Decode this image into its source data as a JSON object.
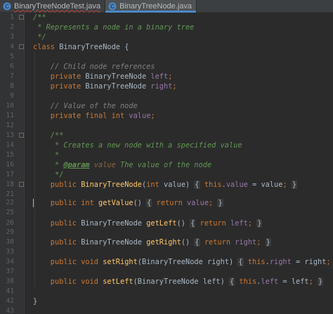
{
  "tabs": [
    {
      "label": "BinaryTreeNodeTest.java",
      "active": false,
      "error": true,
      "icon": "java-class-icon"
    },
    {
      "label": "BinaryTreeNode.java",
      "active": true,
      "error": false,
      "icon": "java-class-icon"
    }
  ],
  "theme": {
    "background": "#2b2b2b",
    "keyword": "#cc7832",
    "method": "#ffc66d",
    "field": "#9876aa",
    "comment": "#808080",
    "javadoc": "#629755",
    "accent": "#4a88c7"
  },
  "current_line_number": "22",
  "code": [
    {
      "n": "1",
      "tokens": [
        [
          "/**",
          "doc"
        ]
      ]
    },
    {
      "n": "2",
      "tokens": [
        [
          " * Represents a node in a binary tree",
          "doc"
        ]
      ]
    },
    {
      "n": "3",
      "tokens": [
        [
          " */",
          "doc"
        ]
      ]
    },
    {
      "n": "4",
      "tokens": [
        [
          "class ",
          "kw"
        ],
        [
          "BinaryTreeNode {",
          "plain"
        ]
      ]
    },
    {
      "n": "5",
      "tokens": []
    },
    {
      "n": "6",
      "tokens": [
        [
          "    // Child node references",
          "cm"
        ]
      ]
    },
    {
      "n": "7",
      "tokens": [
        [
          "    private ",
          "kw"
        ],
        [
          "BinaryTreeNode ",
          "plain"
        ],
        [
          "left",
          "fld"
        ],
        [
          ";",
          "kw"
        ]
      ]
    },
    {
      "n": "8",
      "tokens": [
        [
          "    private ",
          "kw"
        ],
        [
          "BinaryTreeNode ",
          "plain"
        ],
        [
          "right",
          "fld"
        ],
        [
          ";",
          "kw"
        ]
      ]
    },
    {
      "n": "9",
      "tokens": []
    },
    {
      "n": "10",
      "tokens": [
        [
          "    // Value of the node",
          "cm"
        ]
      ]
    },
    {
      "n": "11",
      "tokens": [
        [
          "    private final int ",
          "kw"
        ],
        [
          "value",
          "fld"
        ],
        [
          ";",
          "kw"
        ]
      ]
    },
    {
      "n": "12",
      "tokens": []
    },
    {
      "n": "13",
      "tokens": [
        [
          "    /**",
          "doc"
        ]
      ]
    },
    {
      "n": "14",
      "tokens": [
        [
          "     * Creates a new node with a specified value",
          "doc"
        ]
      ]
    },
    {
      "n": "15",
      "tokens": [
        [
          "     *",
          "doc"
        ]
      ]
    },
    {
      "n": "16",
      "tokens": [
        [
          "     * ",
          "doc"
        ],
        [
          "@param",
          "doctag"
        ],
        [
          " ",
          "doc"
        ],
        [
          "value",
          "docval"
        ],
        [
          " The value of the node",
          "doc"
        ]
      ]
    },
    {
      "n": "17",
      "tokens": [
        [
          "     */",
          "doc"
        ]
      ]
    },
    {
      "n": "18",
      "tokens": [
        [
          "    public ",
          "kw"
        ],
        [
          "BinaryTreeNode",
          "fn"
        ],
        [
          "(",
          "plain"
        ],
        [
          "int ",
          "kw"
        ],
        [
          "value) ",
          "plain"
        ],
        [
          "{",
          "brace"
        ],
        [
          " ",
          "plain"
        ],
        [
          "this",
          "kw"
        ],
        [
          ".",
          "plain"
        ],
        [
          "value",
          "fld"
        ],
        [
          " = value",
          "plain"
        ],
        [
          "; ",
          "kw"
        ],
        [
          "}",
          "brace"
        ]
      ]
    },
    {
      "n": "21",
      "tokens": []
    },
    {
      "n": "22",
      "tokens": [
        [
          "    public int ",
          "kw"
        ],
        [
          "getValue",
          "fn"
        ],
        [
          "() ",
          "plain"
        ],
        [
          "{",
          "brace"
        ],
        [
          " ",
          "plain"
        ],
        [
          "return ",
          "kw"
        ],
        [
          "value",
          "fld"
        ],
        [
          "; ",
          "kw"
        ],
        [
          "}",
          "brace"
        ]
      ]
    },
    {
      "n": "25",
      "tokens": []
    },
    {
      "n": "26",
      "tokens": [
        [
          "    public ",
          "kw"
        ],
        [
          "BinaryTreeNode ",
          "plain"
        ],
        [
          "getLeft",
          "fn"
        ],
        [
          "() ",
          "plain"
        ],
        [
          "{",
          "brace"
        ],
        [
          " ",
          "plain"
        ],
        [
          "return ",
          "kw"
        ],
        [
          "left",
          "fld"
        ],
        [
          "; ",
          "kw"
        ],
        [
          "}",
          "brace"
        ]
      ]
    },
    {
      "n": "29",
      "tokens": []
    },
    {
      "n": "30",
      "tokens": [
        [
          "    public ",
          "kw"
        ],
        [
          "BinaryTreeNode ",
          "plain"
        ],
        [
          "getRight",
          "fn"
        ],
        [
          "() ",
          "plain"
        ],
        [
          "{",
          "brace"
        ],
        [
          " ",
          "plain"
        ],
        [
          "return ",
          "kw"
        ],
        [
          "right",
          "fld"
        ],
        [
          "; ",
          "kw"
        ],
        [
          "}",
          "brace"
        ]
      ]
    },
    {
      "n": "33",
      "tokens": []
    },
    {
      "n": "34",
      "tokens": [
        [
          "    public void ",
          "kw"
        ],
        [
          "setRight",
          "fn"
        ],
        [
          "(BinaryTreeNode right) ",
          "plain"
        ],
        [
          "{",
          "brace"
        ],
        [
          " ",
          "plain"
        ],
        [
          "this",
          "kw"
        ],
        [
          ".",
          "plain"
        ],
        [
          "right",
          "fld"
        ],
        [
          " = right",
          "plain"
        ],
        [
          "; ",
          "kw"
        ],
        [
          "}",
          "brace"
        ]
      ]
    },
    {
      "n": "37",
      "tokens": []
    },
    {
      "n": "38",
      "tokens": [
        [
          "    public void ",
          "kw"
        ],
        [
          "setLeft",
          "fn"
        ],
        [
          "(BinaryTreeNode left) ",
          "plain"
        ],
        [
          "{",
          "brace"
        ],
        [
          " ",
          "plain"
        ],
        [
          "this",
          "kw"
        ],
        [
          ".",
          "plain"
        ],
        [
          "left",
          "fld"
        ],
        [
          " = left",
          "plain"
        ],
        [
          "; ",
          "kw"
        ],
        [
          "}",
          "brace"
        ]
      ]
    },
    {
      "n": "41",
      "tokens": []
    },
    {
      "n": "42",
      "tokens": [
        [
          "}",
          "plain"
        ]
      ]
    },
    {
      "n": "43",
      "tokens": []
    }
  ]
}
